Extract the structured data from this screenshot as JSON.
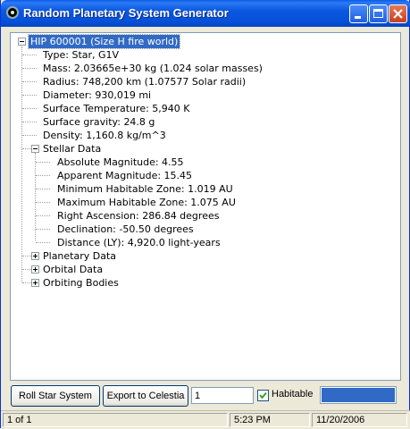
{
  "window": {
    "title": "Random Planetary System Generator"
  },
  "tree": {
    "root": "HIP 600001 (Size H fire world)",
    "properties": [
      "Type: Star, G1V",
      "Mass: 2.03665e+30 kg (1.024 solar masses)",
      "Radius: 748,200 km (1.07577 Solar radii)",
      "Diameter: 930,019 mi",
      "Surface Temperature: 5,940 K",
      "Surface gravity: 24.8 g",
      "Density: 1,160.8 kg/m^3"
    ],
    "stellar_data": {
      "label": "Stellar Data",
      "expanded": true,
      "items": [
        "Absolute Magnitude: 4.55",
        "Apparent Magnitude: 15.45",
        "Minimum Habitable Zone: 1.019 AU",
        "Maximum Habitable Zone: 1.075 AU",
        "Right Ascension: 286.84 degrees",
        "Declination: -50.50 degrees",
        "Distance (LY): 4,920.0 light-years"
      ]
    },
    "collapsed_groups": [
      "Planetary Data",
      "Orbital Data",
      "Orbiting Bodies"
    ]
  },
  "toolbar": {
    "roll_label": "Roll Star System",
    "export_label": "Export to Celestia",
    "count_value": "1",
    "habitable_label": "Habitable",
    "habitable_checked": true,
    "progress_fraction": 1.0
  },
  "status": {
    "page": "1 of 1",
    "time": "5:23 PM",
    "date": "11/20/2006"
  },
  "colors": {
    "selection": "#316ac5",
    "titlebar": "#0650d8",
    "progress": "#316ac5"
  }
}
